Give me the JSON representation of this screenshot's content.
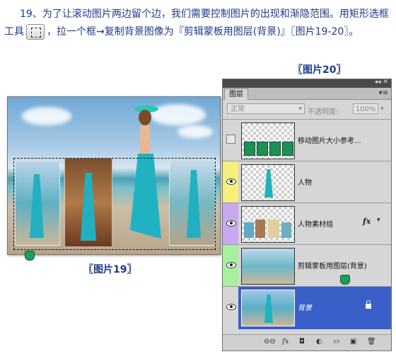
{
  "instruction": {
    "step": "19、",
    "text_before_icon": "为了让滚动图片两边留个边，我们需要控制图片的出现和渐隐范围。用矩形选框工具",
    "text_after_icon": "，拉一个框→复制背景图像为『剪辑蒙板用图层(背景)』〖图片19-20〗。"
  },
  "captions": {
    "fig20": "〖图片20〗",
    "fig19": "〖图片19〗"
  },
  "icons": {
    "marquee_tool": "rectangular-marquee-icon",
    "eye": "eye-icon",
    "lock": "lock-icon",
    "hand_cursor": "hand-cursor-icon"
  },
  "layers_panel": {
    "title_bar_glyphs": "◂◂ ✕",
    "tab": "图层",
    "menu_glyph": "▾≡",
    "blend_mode": "正常",
    "opacity_label": "不透明度:",
    "opacity_value": "100%",
    "layers": [
      {
        "name": "移动图片大小参考...",
        "visible": false,
        "color": "#d6d6d6",
        "selected": false
      },
      {
        "name": "人物",
        "visible": true,
        "color": "#f5f07a",
        "selected": false
      },
      {
        "name": "人物素材组",
        "visible": true,
        "color": "#c9a8f0",
        "selected": false,
        "fx": "fx"
      },
      {
        "name": "剪辑蒙板用图层(背景)",
        "visible": true,
        "color": "#a8f0a0",
        "selected": false
      },
      {
        "name": "背景",
        "visible": true,
        "color": "#d6d6d6",
        "selected": true
      }
    ],
    "bottom_icons": [
      "link-icon",
      "fx-icon",
      "mask-icon",
      "adjustment-icon",
      "group-folder-icon",
      "new-layer-icon",
      "trash-icon"
    ],
    "bottom_glyphs": [
      "⊖⊖",
      "fx",
      "◘",
      "◐",
      "▭",
      "▣",
      "🗑"
    ]
  },
  "colors": {
    "text_blue": "#1f3a8a",
    "selected_layer": "#3a5fc8"
  }
}
